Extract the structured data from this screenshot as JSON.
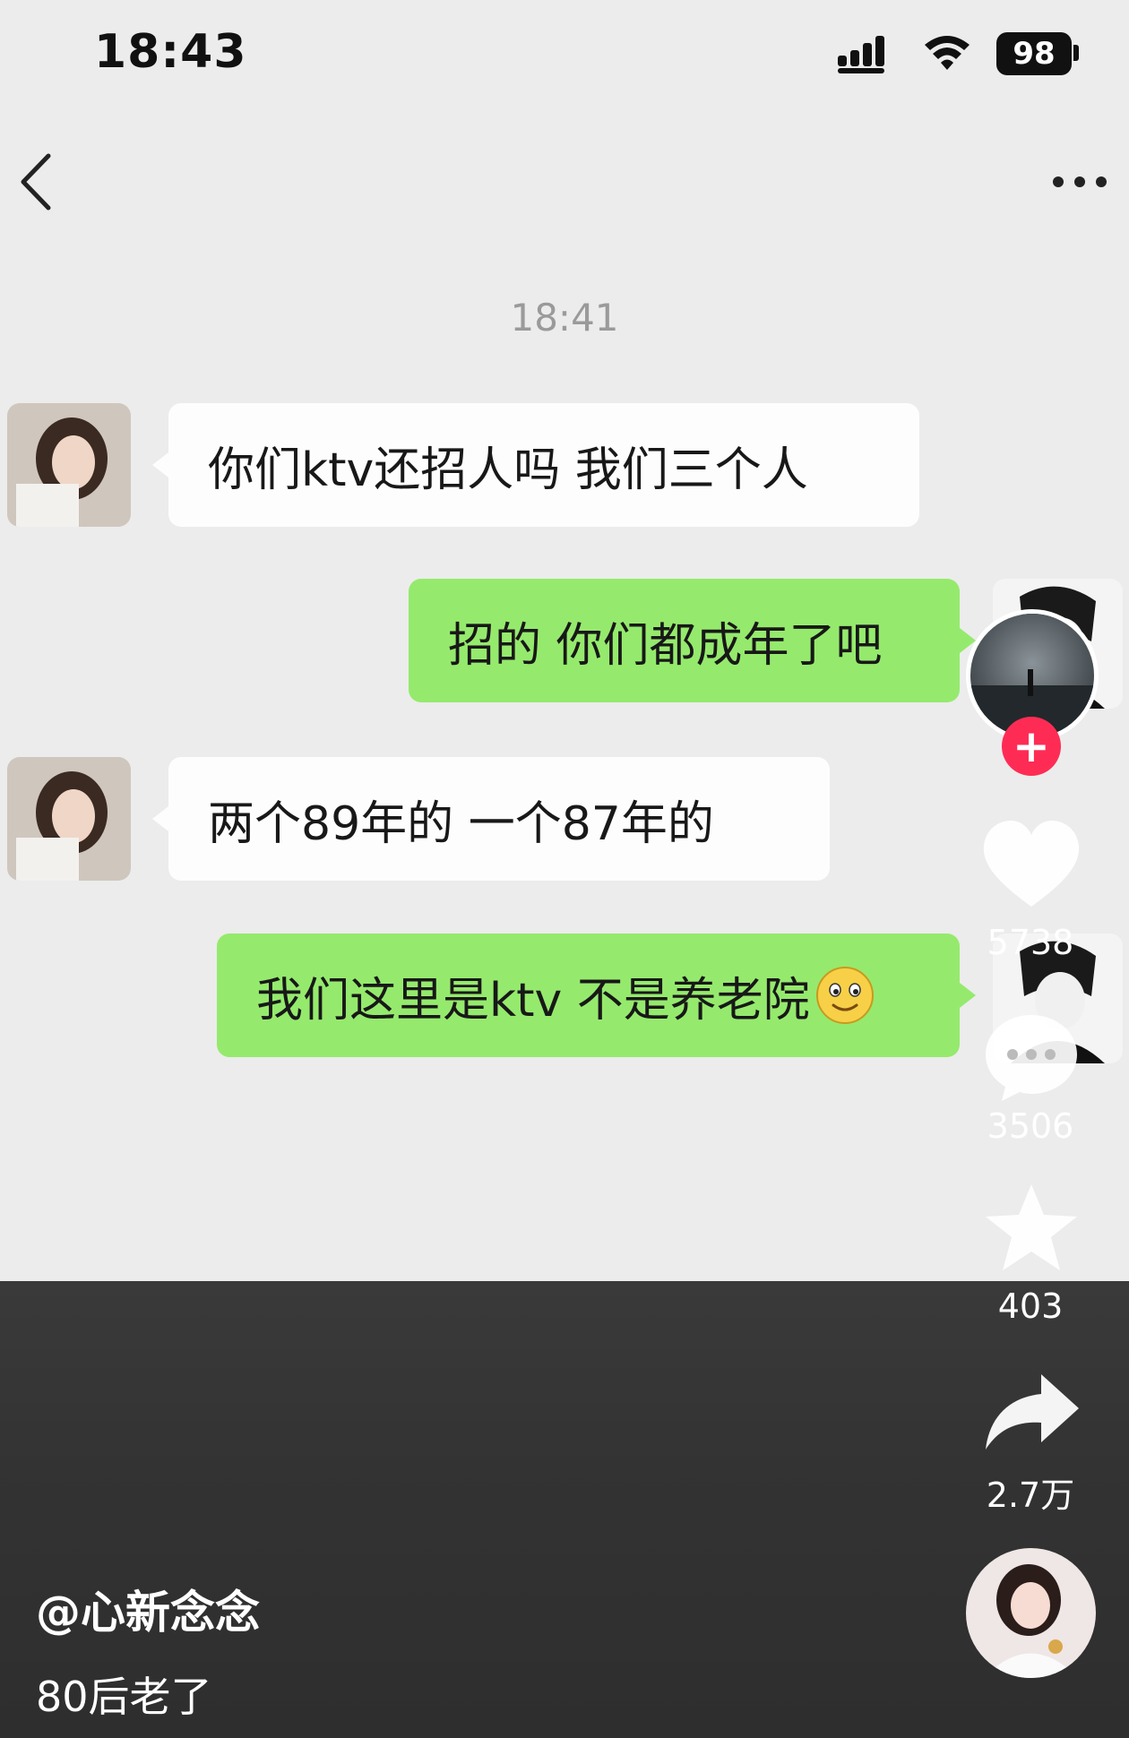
{
  "status_bar": {
    "time": "18:43",
    "battery": "98"
  },
  "chat": {
    "timestamp": "18:41",
    "messages": [
      {
        "side": "left",
        "text": "你们ktv还招人吗  我们三个人"
      },
      {
        "side": "right",
        "text": "招的 你们都成年了吧"
      },
      {
        "side": "left",
        "text": "两个89年的  一个87年的"
      },
      {
        "side": "right",
        "text": "我们这里是ktv 不是养老院"
      }
    ]
  },
  "sidebar": {
    "likes": "5738",
    "comments": "3506",
    "favorites": "403",
    "shares": "2.7万"
  },
  "video_info": {
    "author": "@心新念念",
    "caption": "80后老了"
  },
  "colors": {
    "green_bubble": "#95ea6d",
    "follow_red": "#fe2c55"
  },
  "icons": [
    "back-arrow-icon",
    "more-dots-icon",
    "heart-icon",
    "comment-icon",
    "star-icon",
    "share-icon",
    "plus-icon",
    "smile-emoji-icon"
  ]
}
